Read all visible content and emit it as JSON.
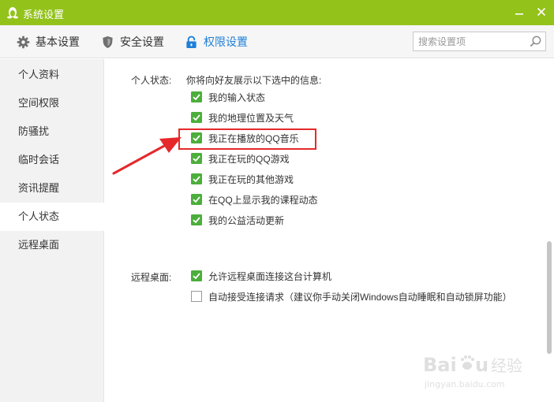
{
  "window": {
    "title": "系统设置",
    "accent_color": "#93c21b",
    "app_icon": "qq-penguin-icon",
    "controls": {
      "minimize_icon": "minimize-icon",
      "close_icon": "close-icon"
    }
  },
  "tabs": [
    {
      "label": "基本设置",
      "icon": "gear-icon",
      "active": false
    },
    {
      "label": "安全设置",
      "icon": "shield-icon",
      "active": false
    },
    {
      "label": "权限设置",
      "icon": "lock-icon",
      "active": true
    }
  ],
  "tab_active_color": "#1e7fd8",
  "search": {
    "placeholder": "搜索设置项",
    "value": ""
  },
  "sidebar": {
    "items": [
      {
        "label": "个人资料",
        "active": false
      },
      {
        "label": "空间权限",
        "active": false
      },
      {
        "label": "防骚扰",
        "active": false
      },
      {
        "label": "临时会话",
        "active": false
      },
      {
        "label": "资讯提醒",
        "active": false
      },
      {
        "label": "个人状态",
        "active": true
      },
      {
        "label": "远程桌面",
        "active": false
      }
    ]
  },
  "personal_status": {
    "section_label": "个人状态:",
    "description": "你将向好友展示以下选中的信息:",
    "options": [
      {
        "label": "我的输入状态",
        "checked": true
      },
      {
        "label": "我的地理位置及天气",
        "checked": true
      },
      {
        "label": "我正在播放的QQ音乐",
        "checked": true,
        "highlighted": true
      },
      {
        "label": "我正在玩的QQ游戏",
        "checked": true
      },
      {
        "label": "我正在玩的其他游戏",
        "checked": true
      },
      {
        "label": "在QQ上显示我的课程动态",
        "checked": true
      },
      {
        "label": "我的公益活动更新",
        "checked": true
      }
    ]
  },
  "remote_desktop": {
    "section_label": "远程桌面:",
    "options": [
      {
        "label": "允许远程桌面连接这台计算机",
        "checked": true
      },
      {
        "label": "自动接受连接请求（建议你手动关闭Windows自动睡眠和自动锁屏功能）",
        "checked": false
      }
    ]
  },
  "checkbox_color": "#4cae3b",
  "annotation_color": "#e5292b",
  "watermark": {
    "logo": "Baidu经验",
    "url": "jingyan.baidu.com"
  }
}
